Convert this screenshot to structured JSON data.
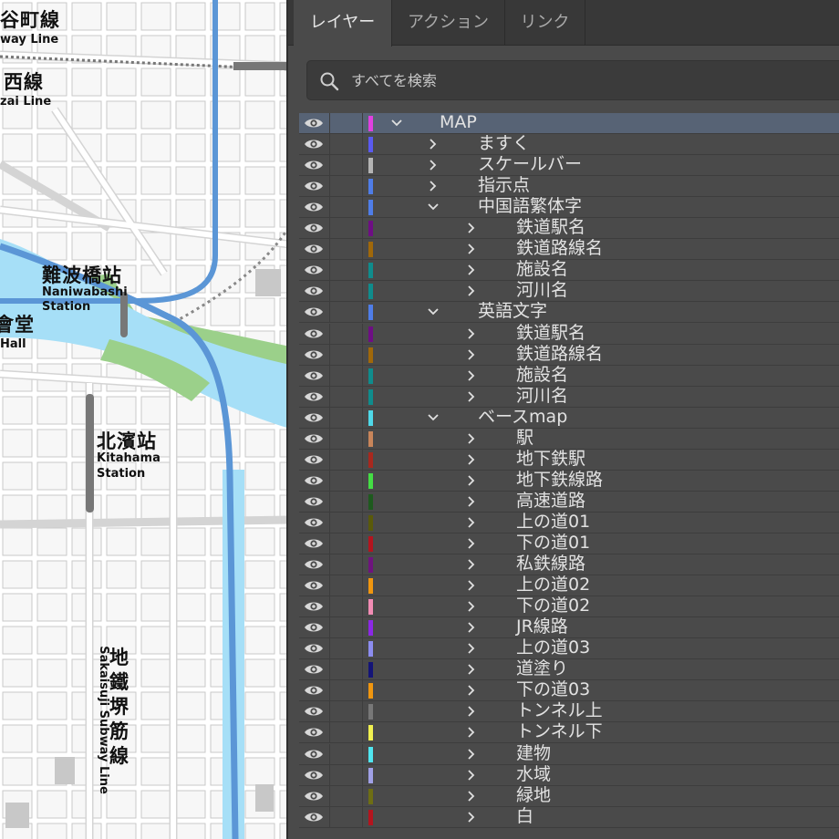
{
  "map": {
    "labels": [
      {
        "name": "map-label-tanimachi-line",
        "text": "谷町線"
      },
      {
        "name": "map-label-subway-line-partial",
        "text": "way Line"
      },
      {
        "name": "map-label-chuo-line",
        "text": "西線"
      },
      {
        "name": "map-label-zai-line-partial",
        "text": "zai Line"
      },
      {
        "name": "map-label-naniwabashi-jp",
        "text": "難波橋站"
      },
      {
        "name": "map-label-naniwabashi-en-1",
        "text": "Naniwabashi"
      },
      {
        "name": "map-label-naniwabashi-en-2",
        "text": "Station"
      },
      {
        "name": "map-label-hall-jp",
        "text": "會堂"
      },
      {
        "name": "map-label-hall-en",
        "text": "Hall"
      },
      {
        "name": "map-label-kitahama-jp",
        "text": "北濱站"
      },
      {
        "name": "map-label-kitahama-en-1",
        "text": "Kitahama"
      },
      {
        "name": "map-label-kitahama-en-2",
        "text": "Station"
      },
      {
        "name": "map-label-sakaisuji-jp",
        "text": "地鐵堺筋線"
      },
      {
        "name": "map-label-sakaisuji-en",
        "text": "Sakaisuji Subway Line"
      }
    ]
  },
  "panel": {
    "tabs": [
      {
        "id": "layers",
        "label": "レイヤー",
        "active": true
      },
      {
        "id": "actions",
        "label": "アクション",
        "active": false
      },
      {
        "id": "links",
        "label": "リンク",
        "active": false
      }
    ],
    "search": {
      "placeholder": "すべてを検索",
      "value": "",
      "icon": "search-icon"
    },
    "layers": [
      {
        "name": "MAP",
        "level": 0,
        "expanded": true,
        "color": "#e040e0",
        "selected": true
      },
      {
        "name": "ますく",
        "level": 1,
        "expanded": false,
        "color": "#5a5af0"
      },
      {
        "name": "スケールバー",
        "level": 1,
        "expanded": false,
        "color": "#b4b4b4"
      },
      {
        "name": "指示点",
        "level": 1,
        "expanded": false,
        "color": "#4f7de8"
      },
      {
        "name": "中国語繁体字",
        "level": 1,
        "expanded": true,
        "color": "#4f7de8"
      },
      {
        "name": "鉄道駅名",
        "level": 2,
        "expanded": false,
        "color": "#6e0e84"
      },
      {
        "name": "鉄道路線名",
        "level": 2,
        "expanded": false,
        "color": "#a0680a"
      },
      {
        "name": "施設名",
        "level": 2,
        "expanded": false,
        "color": "#0f8c8c"
      },
      {
        "name": "河川名",
        "level": 2,
        "expanded": false,
        "color": "#0f8c8c"
      },
      {
        "name": "英語文字",
        "level": 1,
        "expanded": true,
        "color": "#4f7de8"
      },
      {
        "name": "鉄道駅名",
        "level": 2,
        "expanded": false,
        "color": "#6e0e84"
      },
      {
        "name": "鉄道路線名",
        "level": 2,
        "expanded": false,
        "color": "#a0680a"
      },
      {
        "name": "施設名",
        "level": 2,
        "expanded": false,
        "color": "#0f8c8c"
      },
      {
        "name": "河川名",
        "level": 2,
        "expanded": false,
        "color": "#0f8c8c"
      },
      {
        "name": "ベースmap",
        "level": 1,
        "expanded": true,
        "color": "#4fd8e8"
      },
      {
        "name": "駅",
        "level": 2,
        "expanded": false,
        "color": "#c8855a"
      },
      {
        "name": "地下鉄駅",
        "level": 2,
        "expanded": false,
        "color": "#a8281e"
      },
      {
        "name": "地下鉄線路",
        "level": 2,
        "expanded": false,
        "color": "#44dd44"
      },
      {
        "name": "高速道路",
        "level": 2,
        "expanded": false,
        "color": "#1e5a1e"
      },
      {
        "name": "上の道01",
        "level": 2,
        "expanded": false,
        "color": "#5a5a0a"
      },
      {
        "name": "下の道01",
        "level": 2,
        "expanded": false,
        "color": "#b4141e"
      },
      {
        "name": "私鉄線路",
        "level": 2,
        "expanded": false,
        "color": "#6e147e"
      },
      {
        "name": "上の道02",
        "level": 2,
        "expanded": false,
        "color": "#f0960f"
      },
      {
        "name": "下の道02",
        "level": 2,
        "expanded": false,
        "color": "#f28cb4"
      },
      {
        "name": "JR線路",
        "level": 2,
        "expanded": false,
        "color": "#8c28e6"
      },
      {
        "name": "上の道03",
        "level": 2,
        "expanded": false,
        "color": "#8c8cf0"
      },
      {
        "name": "道塗り",
        "level": 2,
        "expanded": false,
        "color": "#141478"
      },
      {
        "name": "下の道03",
        "level": 2,
        "expanded": false,
        "color": "#f0960f"
      },
      {
        "name": "トンネル上",
        "level": 2,
        "expanded": false,
        "color": "#787878"
      },
      {
        "name": "トンネル下",
        "level": 2,
        "expanded": false,
        "color": "#f0f050"
      },
      {
        "name": "建物",
        "level": 2,
        "expanded": false,
        "color": "#50e6f0"
      },
      {
        "name": "水域",
        "level": 2,
        "expanded": false,
        "color": "#a0a0e6"
      },
      {
        "name": "緑地",
        "level": 2,
        "expanded": false,
        "color": "#6e6e14"
      },
      {
        "name": "白",
        "level": 2,
        "expanded": false,
        "color": "#b4141e"
      }
    ]
  }
}
